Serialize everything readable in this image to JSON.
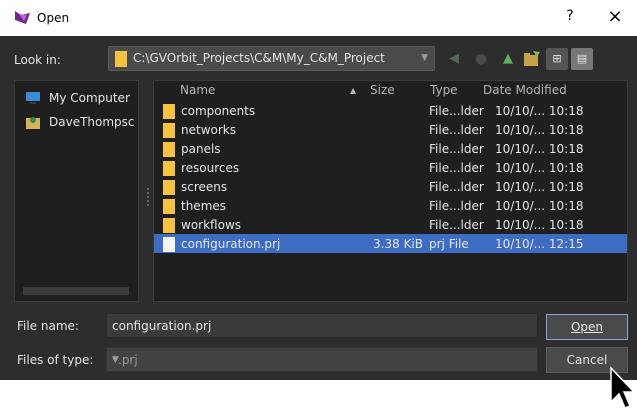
{
  "window": {
    "title": "Open",
    "help": "?",
    "close": "×"
  },
  "toolbar": {
    "look_in_label": "Look in:",
    "path": "C:\\GVOrbit_Projects\\C&M\\My_C&M_Project"
  },
  "sidebar": {
    "items": [
      {
        "label": "My Computer",
        "icon": "computer-icon"
      },
      {
        "label": "DaveThompsc",
        "icon": "user-folder-icon"
      }
    ]
  },
  "files": {
    "columns": [
      "Name",
      "Size",
      "Type",
      "Date Modified"
    ],
    "rows": [
      {
        "name": "components",
        "size": "",
        "type": "File...lder",
        "date": "10/10/... 10:18",
        "kind": "folder"
      },
      {
        "name": "networks",
        "size": "",
        "type": "File...lder",
        "date": "10/10/... 10:18",
        "kind": "folder"
      },
      {
        "name": "panels",
        "size": "",
        "type": "File...lder",
        "date": "10/10/... 10:18",
        "kind": "folder"
      },
      {
        "name": "resources",
        "size": "",
        "type": "File...lder",
        "date": "10/10/... 10:18",
        "kind": "folder"
      },
      {
        "name": "screens",
        "size": "",
        "type": "File...lder",
        "date": "10/10/... 10:18",
        "kind": "folder"
      },
      {
        "name": "themes",
        "size": "",
        "type": "File...lder",
        "date": "10/10/... 10:18",
        "kind": "folder"
      },
      {
        "name": "workflows",
        "size": "",
        "type": "File...lder",
        "date": "10/10/... 10:18",
        "kind": "folder"
      },
      {
        "name": "configuration.prj",
        "size": "3.38 KiB",
        "type": "prj File",
        "date": "10/10/... 12:15",
        "kind": "file",
        "selected": true
      }
    ]
  },
  "file_name": {
    "label": "File name:",
    "value": "configuration.prj"
  },
  "file_type": {
    "label": "Files of type:",
    "value": "*.prj"
  },
  "buttons": {
    "open": "Open",
    "cancel": "Cancel"
  },
  "colors": {
    "dialog_bg": "#2d2d2d",
    "panel_bg": "#1f1f1f",
    "selection": "#3d6dc2",
    "folder": "#f5c242"
  }
}
